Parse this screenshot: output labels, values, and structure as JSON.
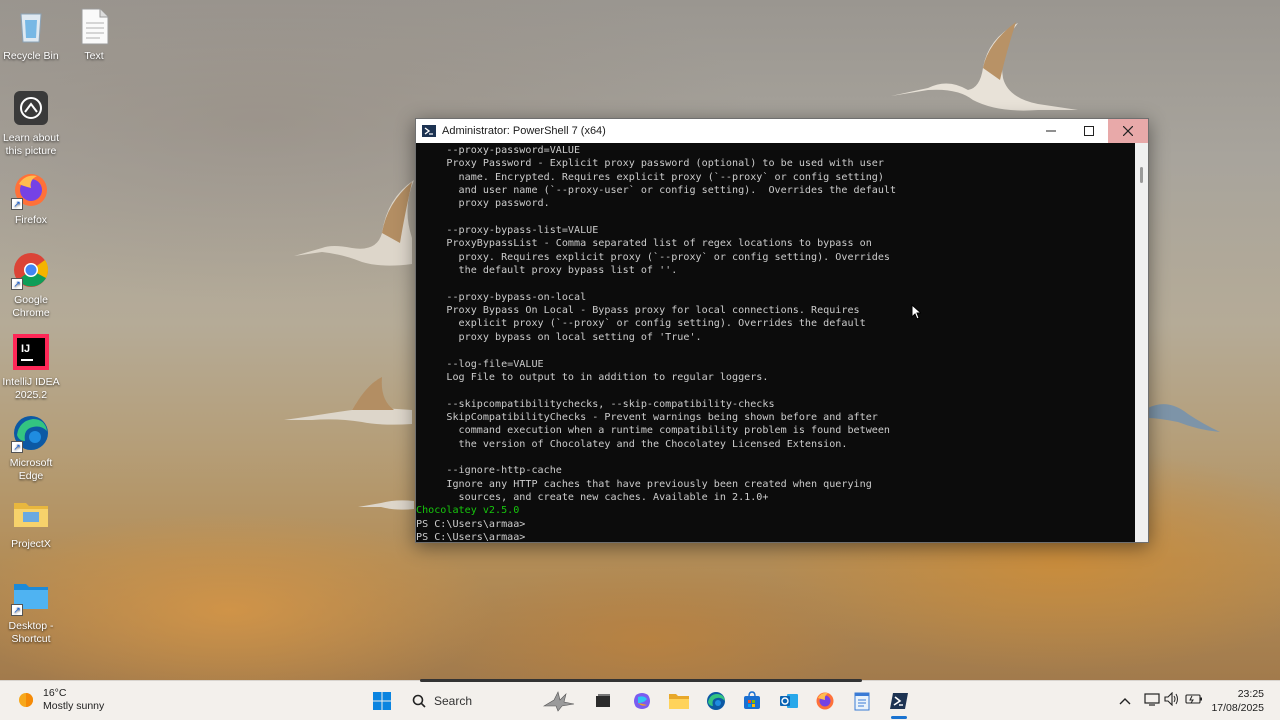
{
  "desktop": {
    "icons": [
      {
        "label": "Recycle Bin",
        "icon": "recycle-bin-icon"
      },
      {
        "label": "Text",
        "icon": "text-file-icon"
      },
      {
        "label": "Learn about this picture",
        "icon": "camera-icon"
      },
      {
        "label": "Firefox",
        "icon": "firefox-icon"
      },
      {
        "label": "Google Chrome",
        "icon": "chrome-icon"
      },
      {
        "label": "IntelliJ IDEA 2025.2",
        "icon": "intellij-icon"
      },
      {
        "label": "Microsoft Edge",
        "icon": "edge-icon"
      },
      {
        "label": "ProjectX",
        "icon": "folder-icon"
      },
      {
        "label": "Desktop - Shortcut",
        "icon": "desktop-folder-icon"
      }
    ]
  },
  "window": {
    "title": "Administrator: PowerShell 7 (x64)",
    "controls": {
      "minimize": "minimize-icon",
      "maximize": "maximize-icon",
      "close": "close-icon"
    },
    "lines": [
      {
        "text": "     --proxy-password=VALUE",
        "color": "default"
      },
      {
        "text": "     Proxy Password - Explicit proxy password (optional) to be used with user",
        "color": "default"
      },
      {
        "text": "       name. Encrypted. Requires explicit proxy (`--proxy` or config setting)",
        "color": "default"
      },
      {
        "text": "       and user name (`--proxy-user` or config setting).  Overrides the default",
        "color": "default"
      },
      {
        "text": "       proxy password.",
        "color": "default"
      },
      {
        "text": "",
        "color": "default"
      },
      {
        "text": "     --proxy-bypass-list=VALUE",
        "color": "default"
      },
      {
        "text": "     ProxyBypassList - Comma separated list of regex locations to bypass on",
        "color": "default"
      },
      {
        "text": "       proxy. Requires explicit proxy (`--proxy` or config setting). Overrides",
        "color": "default"
      },
      {
        "text": "       the default proxy bypass list of ''.",
        "color": "default"
      },
      {
        "text": "",
        "color": "default"
      },
      {
        "text": "     --proxy-bypass-on-local",
        "color": "default"
      },
      {
        "text": "     Proxy Bypass On Local - Bypass proxy for local connections. Requires",
        "color": "default"
      },
      {
        "text": "       explicit proxy (`--proxy` or config setting). Overrides the default",
        "color": "default"
      },
      {
        "text": "       proxy bypass on local setting of 'True'.",
        "color": "default"
      },
      {
        "text": "",
        "color": "default"
      },
      {
        "text": "     --log-file=VALUE",
        "color": "default"
      },
      {
        "text": "     Log File to output to in addition to regular loggers.",
        "color": "default"
      },
      {
        "text": "",
        "color": "default"
      },
      {
        "text": "     --skipcompatibilitychecks, --skip-compatibility-checks",
        "color": "default"
      },
      {
        "text": "     SkipCompatibilityChecks - Prevent warnings being shown before and after",
        "color": "default"
      },
      {
        "text": "       command execution when a runtime compatibility problem is found between",
        "color": "default"
      },
      {
        "text": "       the version of Chocolatey and the Chocolatey Licensed Extension.",
        "color": "default"
      },
      {
        "text": "",
        "color": "default"
      },
      {
        "text": "     --ignore-http-cache",
        "color": "default"
      },
      {
        "text": "     Ignore any HTTP caches that have previously been created when querying",
        "color": "default"
      },
      {
        "text": "       sources, and create new caches. Available in 2.1.0+",
        "color": "default"
      },
      {
        "text": "Chocolatey v2.5.0",
        "color": "green"
      },
      {
        "text": "PS C:\\Users\\armaa>",
        "color": "default"
      },
      {
        "text": "PS C:\\Users\\armaa>",
        "color": "default"
      }
    ],
    "colors": {
      "terminal_bg": "#0c0c0c",
      "text": "#cccccc",
      "green": "#16c60c"
    }
  },
  "taskbar": {
    "weather": {
      "temp": "16°C",
      "condition": "Mostly sunny",
      "icon": "sun-icon"
    },
    "search_placeholder": "Search",
    "pinned": [
      "windows-start-icon",
      "search-icon",
      "copilot-bird-icon",
      "task-view-icon",
      "copilot-icon",
      "file-explorer-icon",
      "edge-icon",
      "store-icon",
      "outlook-icon",
      "firefox-icon",
      "notepad-icon",
      "powershell-icon"
    ],
    "tray": [
      "chevron-up-icon",
      "network-icon",
      "volume-icon",
      "battery-icon"
    ],
    "clock": {
      "time": "23:25",
      "date": "17/08/2025"
    }
  }
}
